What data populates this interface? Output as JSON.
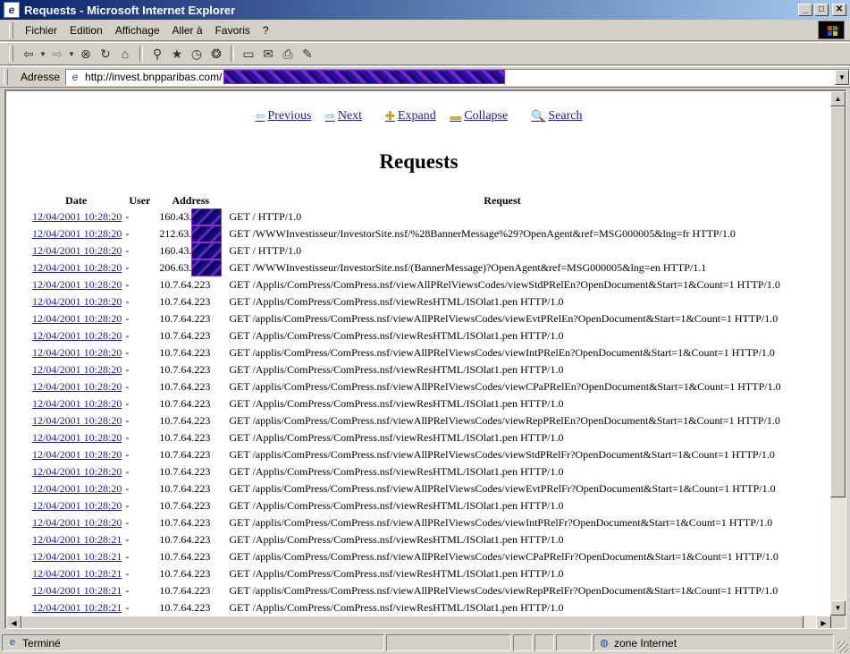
{
  "window": {
    "title": "Requests - Microsoft Internet Explorer",
    "buttons": {
      "minimize": "_",
      "maximize": "□",
      "close": "✕"
    }
  },
  "menu": [
    {
      "label": "Fichier"
    },
    {
      "label": "Edition"
    },
    {
      "label": "Affichage"
    },
    {
      "label": "Aller à"
    },
    {
      "label": "Favoris"
    },
    {
      "label": "?"
    }
  ],
  "toolbar": {
    "back": "⇦",
    "forward": "⇨",
    "stop": "⊗",
    "refresh": "↻",
    "home": "⌂",
    "search": "⚲",
    "favorites": "★",
    "history": "◷",
    "channels": "❂",
    "fullscreen": "▭",
    "mail": "✉",
    "print": "⎙",
    "edit": "✎",
    "dropdown": "▼"
  },
  "address": {
    "label": "Adresse",
    "url": "http://invest.bnpparibas.com/",
    "dropdown": "▼"
  },
  "page": {
    "nav": {
      "previous": "Previous",
      "next": "Next",
      "expand": "Expand",
      "collapse": "Collapse",
      "search": "Search",
      "icons": {
        "previous": "⇦",
        "next": "⇨",
        "expand": "✚",
        "collapse": "▬",
        "search": "🔍"
      }
    },
    "title": "Requests",
    "columns": {
      "date": "Date",
      "user": "User",
      "address": "Address",
      "request": "Request"
    },
    "rows": [
      {
        "date": "12/04/2001 10:28:20",
        "user": "-",
        "address": "160.43.",
        "request": "GET / HTTP/1.0",
        "masked": true
      },
      {
        "date": "12/04/2001 10:28:20",
        "user": "-",
        "address": "212.63.",
        "request": "GET /WWWInvestisseur/InvestorSite.nsf/%28BannerMessage%29?OpenAgent&ref=MSG000005&lng=fr HTTP/1.0",
        "masked": true
      },
      {
        "date": "12/04/2001 10:28:20",
        "user": "-",
        "address": "160.43.",
        "request": "GET / HTTP/1.0",
        "masked": true
      },
      {
        "date": "12/04/2001 10:28:20",
        "user": "-",
        "address": "206.63.",
        "request": "GET /WWWInvestisseur/InvestorSite.nsf/(BannerMessage)?OpenAgent&ref=MSG000005&lng=en HTTP/1.1",
        "masked": true
      },
      {
        "date": "12/04/2001 10:28:20",
        "user": "-",
        "address": "10.7.64.223",
        "request": "GET /Applis/ComPress/ComPress.nsf/viewAllPRelViewsCodes/viewStdPRelEn?OpenDocument&Start=1&Count=1 HTTP/1.0"
      },
      {
        "date": "12/04/2001 10:28:20",
        "user": "-",
        "address": "10.7.64.223",
        "request": "GET /Applis/ComPress/ComPress.nsf/viewResHTML/ISOlat1.pen HTTP/1.0"
      },
      {
        "date": "12/04/2001 10:28:20",
        "user": "-",
        "address": "10.7.64.223",
        "request": "GET /applis/ComPress/ComPress.nsf/viewAllPRelViewsCodes/viewEvtPRelEn?OpenDocument&Start=1&Count=1 HTTP/1.0"
      },
      {
        "date": "12/04/2001 10:28:20",
        "user": "-",
        "address": "10.7.64.223",
        "request": "GET /Applis/ComPress/ComPress.nsf/viewResHTML/ISOlat1.pen HTTP/1.0"
      },
      {
        "date": "12/04/2001 10:28:20",
        "user": "-",
        "address": "10.7.64.223",
        "request": "GET /applis/ComPress/ComPress.nsf/viewAllPRelViewsCodes/viewIntPRelEn?OpenDocument&Start=1&Count=1 HTTP/1.0"
      },
      {
        "date": "12/04/2001 10:28:20",
        "user": "-",
        "address": "10.7.64.223",
        "request": "GET /Applis/ComPress/ComPress.nsf/viewResHTML/ISOlat1.pen HTTP/1.0"
      },
      {
        "date": "12/04/2001 10:28:20",
        "user": "-",
        "address": "10.7.64.223",
        "request": "GET /applis/ComPress/ComPress.nsf/viewAllPRelViewsCodes/viewCPaPRelEn?OpenDocument&Start=1&Count=1 HTTP/1.0"
      },
      {
        "date": "12/04/2001 10:28:20",
        "user": "-",
        "address": "10.7.64.223",
        "request": "GET /Applis/ComPress/ComPress.nsf/viewResHTML/ISOlat1.pen HTTP/1.0"
      },
      {
        "date": "12/04/2001 10:28:20",
        "user": "-",
        "address": "10.7.64.223",
        "request": "GET /applis/ComPress/ComPress.nsf/viewAllPRelViewsCodes/viewRepPRelEn?OpenDocument&Start=1&Count=1 HTTP/1.0"
      },
      {
        "date": "12/04/2001 10:28:20",
        "user": "-",
        "address": "10.7.64.223",
        "request": "GET /Applis/ComPress/ComPress.nsf/viewResHTML/ISOlat1.pen HTTP/1.0"
      },
      {
        "date": "12/04/2001 10:28:20",
        "user": "-",
        "address": "10.7.64.223",
        "request": "GET /applis/ComPress/ComPress.nsf/viewAllPRelViewsCodes/viewStdPRelFr?OpenDocument&Start=1&Count=1 HTTP/1.0"
      },
      {
        "date": "12/04/2001 10:28:20",
        "user": "-",
        "address": "10.7.64.223",
        "request": "GET /Applis/ComPress/ComPress.nsf/viewResHTML/ISOlat1.pen HTTP/1.0"
      },
      {
        "date": "12/04/2001 10:28:20",
        "user": "-",
        "address": "10.7.64.223",
        "request": "GET /applis/ComPress/ComPress.nsf/viewAllPRelViewsCodes/viewEvtPRelFr?OpenDocument&Start=1&Count=1 HTTP/1.0"
      },
      {
        "date": "12/04/2001 10:28:20",
        "user": "-",
        "address": "10.7.64.223",
        "request": "GET /Applis/ComPress/ComPress.nsf/viewResHTML/ISOlat1.pen HTTP/1.0"
      },
      {
        "date": "12/04/2001 10:28:20",
        "user": "-",
        "address": "10.7.64.223",
        "request": "GET /applis/ComPress/ComPress.nsf/viewAllPRelViewsCodes/viewIntPRelFr?OpenDocument&Start=1&Count=1 HTTP/1.0"
      },
      {
        "date": "12/04/2001 10:28:21",
        "user": "-",
        "address": "10.7.64.223",
        "request": "GET /Applis/ComPress/ComPress.nsf/viewResHTML/ISOlat1.pen HTTP/1.0"
      },
      {
        "date": "12/04/2001 10:28:21",
        "user": "-",
        "address": "10.7.64.223",
        "request": "GET /applis/ComPress/ComPress.nsf/viewAllPRelViewsCodes/viewCPaPRelFr?OpenDocument&Start=1&Count=1 HTTP/1.0"
      },
      {
        "date": "12/04/2001 10:28:21",
        "user": "-",
        "address": "10.7.64.223",
        "request": "GET /Applis/ComPress/ComPress.nsf/viewResHTML/ISOlat1.pen HTTP/1.0"
      },
      {
        "date": "12/04/2001 10:28:21",
        "user": "-",
        "address": "10.7.64.223",
        "request": "GET /applis/ComPress/ComPress.nsf/viewAllPRelViewsCodes/viewRepPRelFr?OpenDocument&Start=1&Count=1 HTTP/1.0"
      },
      {
        "date": "12/04/2001 10:28:21",
        "user": "-",
        "address": "10.7.64.223",
        "request": "GET /Applis/ComPress/ComPress.nsf/viewResHTML/ISOlat1.pen HTTP/1.0"
      }
    ]
  },
  "scroll": {
    "up": "▲",
    "down": "▼",
    "left": "◀",
    "right": "▶"
  },
  "status": {
    "text": "Terminé",
    "zone": "zone Internet"
  },
  "colors": {
    "link": "#1a1aa6",
    "titlebar_start": "#0a246a",
    "titlebar_end": "#a6caf0"
  }
}
